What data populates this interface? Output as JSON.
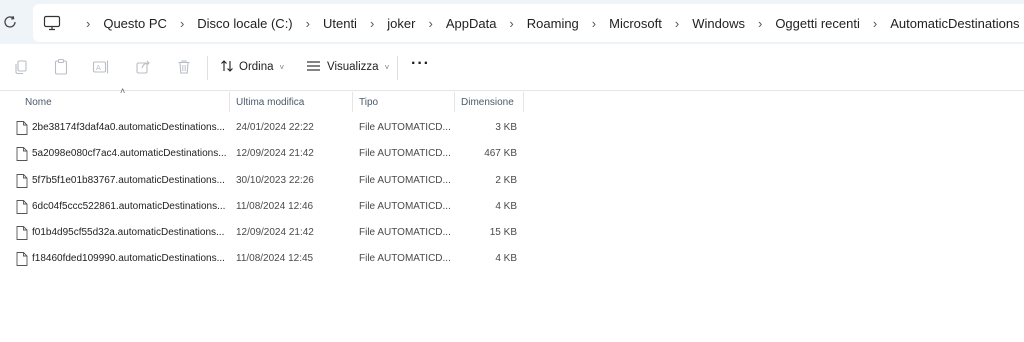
{
  "address_bar": {
    "breadcrumbs": [
      "Questo PC",
      "Disco locale (C:)",
      "Utenti",
      "joker",
      "AppData",
      "Roaming",
      "Microsoft",
      "Windows",
      "Oggetti recenti",
      "AutomaticDestinations"
    ]
  },
  "toolbar": {
    "sort_label": "Ordina",
    "view_label": "Visualizza",
    "more_label": "···"
  },
  "columns": {
    "name": "Nome",
    "modified": "Ultima modifica",
    "type": "Tipo",
    "size": "Dimensione"
  },
  "files": [
    {
      "name": "2be38174f3daf4a0.automaticDestinations...",
      "modified": "24/01/2024 22:22",
      "type": "File AUTOMATICD...",
      "size": "3 KB"
    },
    {
      "name": "5a2098e080cf7ac4.automaticDestinations...",
      "modified": "12/09/2024 21:42",
      "type": "File AUTOMATICD...",
      "size": "467 KB"
    },
    {
      "name": "5f7b5f1e01b83767.automaticDestinations...",
      "modified": "30/10/2023 22:26",
      "type": "File AUTOMATICD...",
      "size": "2 KB"
    },
    {
      "name": "6dc04f5ccc522861.automaticDestinations...",
      "modified": "11/08/2024 12:46",
      "type": "File AUTOMATICD...",
      "size": "4 KB"
    },
    {
      "name": "f01b4d95cf55d32a.automaticDestinations...",
      "modified": "12/09/2024 21:42",
      "type": "File AUTOMATICD...",
      "size": "15 KB"
    },
    {
      "name": "f18460fded109990.automaticDestinations...",
      "modified": "11/08/2024 12:45",
      "type": "File AUTOMATICD...",
      "size": "4 KB"
    }
  ],
  "icons": {
    "refresh": "refresh-icon",
    "computer": "computer-icon",
    "copy": "copy-icon",
    "paste": "paste-icon",
    "rename": "rename-icon",
    "share": "share-icon",
    "delete": "delete-icon",
    "sort": "sort-icon",
    "view": "view-icon",
    "file": "file-icon"
  },
  "colors": {
    "address_bg": "#eff4f9",
    "header_text": "#4a5a6a",
    "disabled_icon": "#b8bec6"
  }
}
